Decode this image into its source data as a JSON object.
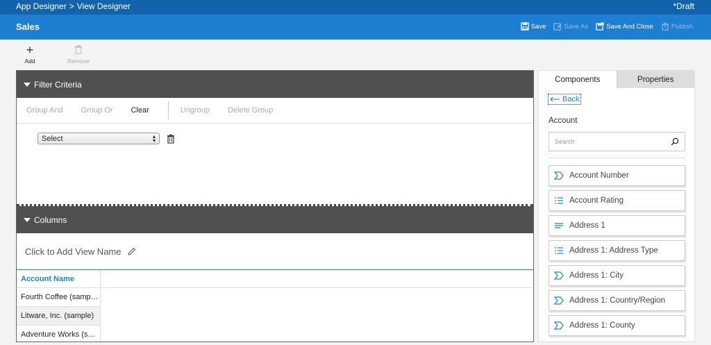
{
  "breadcrumb": {
    "app": "App Designer",
    "separator": ">",
    "view": "View Designer"
  },
  "status": "*Draft",
  "header": {
    "title": "Sales",
    "actions": [
      {
        "label": "Save",
        "icon": "save-icon",
        "enabled": true
      },
      {
        "label": "Save As",
        "icon": "save-as-icon",
        "enabled": false
      },
      {
        "label": "Save And Close",
        "icon": "save-and-close-icon",
        "enabled": true
      },
      {
        "label": "Publish",
        "icon": "publish-icon",
        "enabled": false
      }
    ]
  },
  "toolbar": {
    "add_label": "Add",
    "remove_label": "Remove"
  },
  "filter": {
    "title": "Filter Criteria",
    "tools": {
      "group_and": "Group And",
      "group_or": "Group Or",
      "clear": "Clear",
      "ungroup": "Ungroup",
      "delete_group": "Delete Group"
    },
    "select_value": "Select"
  },
  "columns": {
    "title": "Columns",
    "view_name_prompt": "Click to Add View Name",
    "header": "Account Name",
    "rows": [
      "Fourth Coffee (samp…",
      "Litware, Inc. (sample)",
      "Adventure Works (s…"
    ]
  },
  "panel": {
    "tabs": {
      "components": "Components",
      "properties": "Properties"
    },
    "back_label": "Back",
    "entity": "Account",
    "search_placeholder": "Search",
    "fields": [
      {
        "label": "Account Number",
        "icon": "lookup-field-icon"
      },
      {
        "label": "Account Rating",
        "icon": "option-set-icon"
      },
      {
        "label": "Address 1",
        "icon": "text-field-icon"
      },
      {
        "label": "Address 1: Address Type",
        "icon": "option-set-icon"
      },
      {
        "label": "Address 1: City",
        "icon": "lookup-field-icon"
      },
      {
        "label": "Address 1: Country/Region",
        "icon": "lookup-field-icon"
      },
      {
        "label": "Address 1: County",
        "icon": "lookup-field-icon"
      }
    ]
  },
  "colors": {
    "topbar": "#1363ac",
    "titlebar": "#1e7fd2",
    "section_header": "#505050",
    "accent": "#1e7fd2"
  }
}
